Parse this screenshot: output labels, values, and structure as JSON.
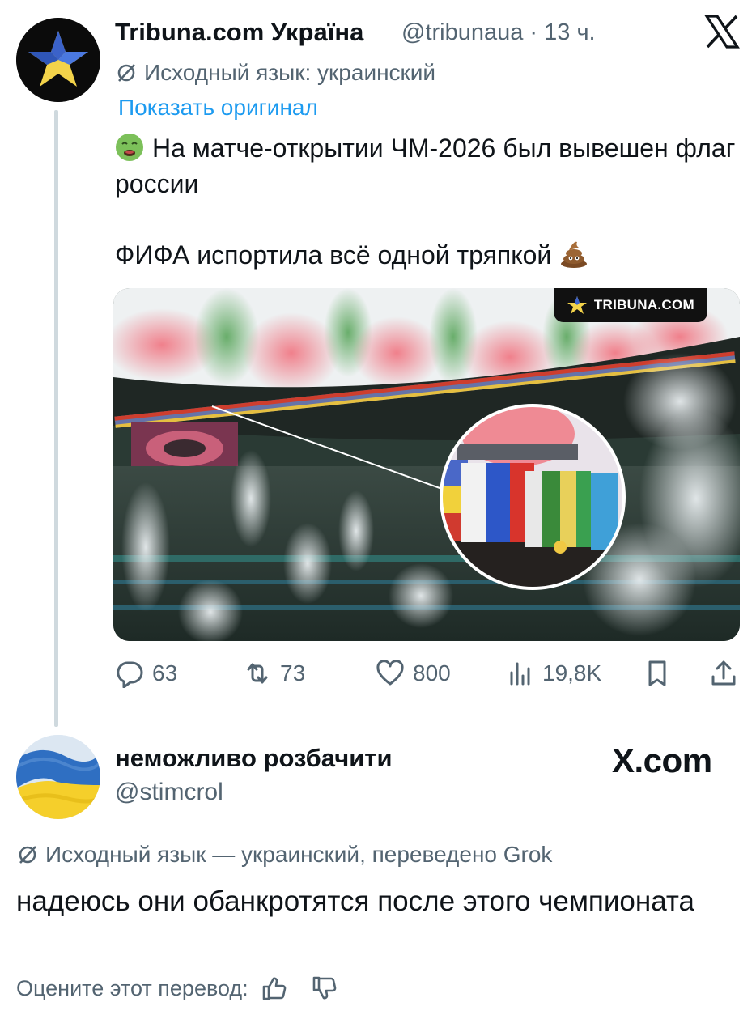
{
  "tweet": {
    "author_name": "Tribuna.com Україна",
    "handle_time": "@tribunaua · 13 ч.",
    "translation_note": "Исходный язык: украинский",
    "show_original": "Показать оригинал",
    "text_line1": "На матче-открытии ЧМ-2026 был вывешен флаг россии",
    "text_line2": "ФИФА испортила всё одной тряпкой",
    "media_badge": "TRIBUNA.COM",
    "actions": {
      "replies": "63",
      "reposts": "73",
      "likes": "800",
      "views": "19,8K"
    }
  },
  "reply": {
    "author_name": "неможливо розбачити",
    "handle": "@stimcrol",
    "watermark": "X.com",
    "translation_note": "Исходный язык — украинский, переведено Grok",
    "text": "надеюсь они обанкротятся после этого чемпионата",
    "rate_label": "Оцените этот перевод:"
  },
  "colors": {
    "text_primary": "#0f1419",
    "text_secondary": "#536471",
    "link": "#1d9bf0",
    "thread_line": "#cfd9de"
  },
  "icons": {
    "close": "x-logo-icon",
    "translate": "translate-icon",
    "reply": "reply-icon",
    "repost": "repost-icon",
    "like": "heart-icon",
    "views": "views-icon",
    "bookmark": "bookmark-icon",
    "share": "share-icon",
    "thumbs_up": "thumbs-up-icon",
    "thumbs_down": "thumbs-down-icon"
  }
}
